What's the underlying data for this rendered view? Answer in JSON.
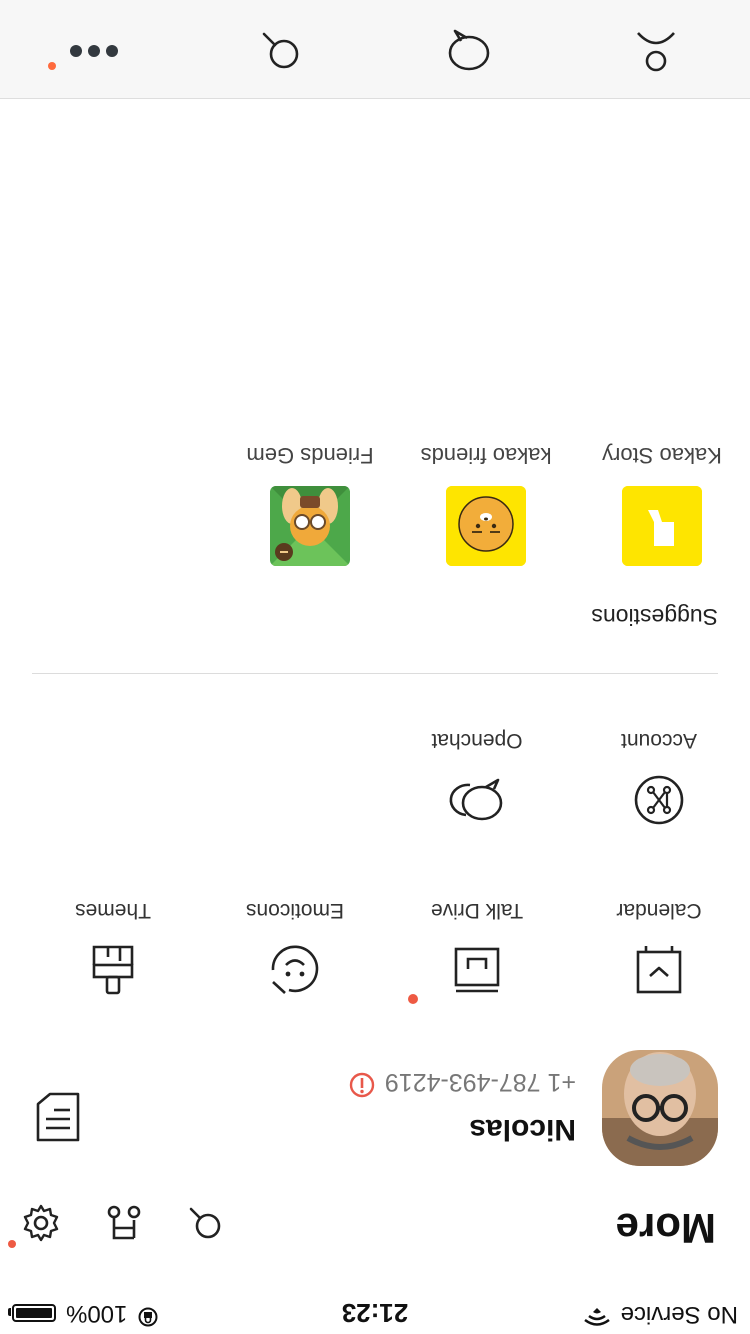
{
  "status_bar": {
    "carrier": "No Service",
    "time": "21:23",
    "battery": "100%",
    "battery_level": 1.0
  },
  "header": {
    "title": "More",
    "icons": [
      "search-icon",
      "music-note-icon",
      "gear-icon"
    ]
  },
  "profile": {
    "name": "Nicolas",
    "phone": "+1 787-493-4219",
    "phone_status_icon": "info-icon"
  },
  "menu": {
    "row1": [
      {
        "label": "Calendar",
        "icon": "calendar-icon"
      },
      {
        "label": "Talk Drive",
        "icon": "drive-icon",
        "badge": true
      },
      {
        "label": "Emoticons",
        "icon": "emoticon-icon"
      },
      {
        "label": "Themes",
        "icon": "paint-brush-icon"
      }
    ],
    "row2": [
      {
        "label": "Account",
        "icon": "account-icon"
      },
      {
        "label": "Openchat",
        "icon": "openchat-icon"
      }
    ]
  },
  "suggestions": {
    "title": "Suggestions",
    "apps": [
      {
        "label": "Kakao Story"
      },
      {
        "label": "kakao friends"
      },
      {
        "label": "Friends Gem"
      }
    ]
  },
  "tab_bar": {
    "tabs": [
      "friends-tab",
      "chats-tab",
      "search-tab",
      "more-tab"
    ],
    "active": "more-tab"
  },
  "colors": {
    "accent_yellow": "#fee500",
    "badge_red": "#ee5a43",
    "info_red": "#e8584a"
  }
}
